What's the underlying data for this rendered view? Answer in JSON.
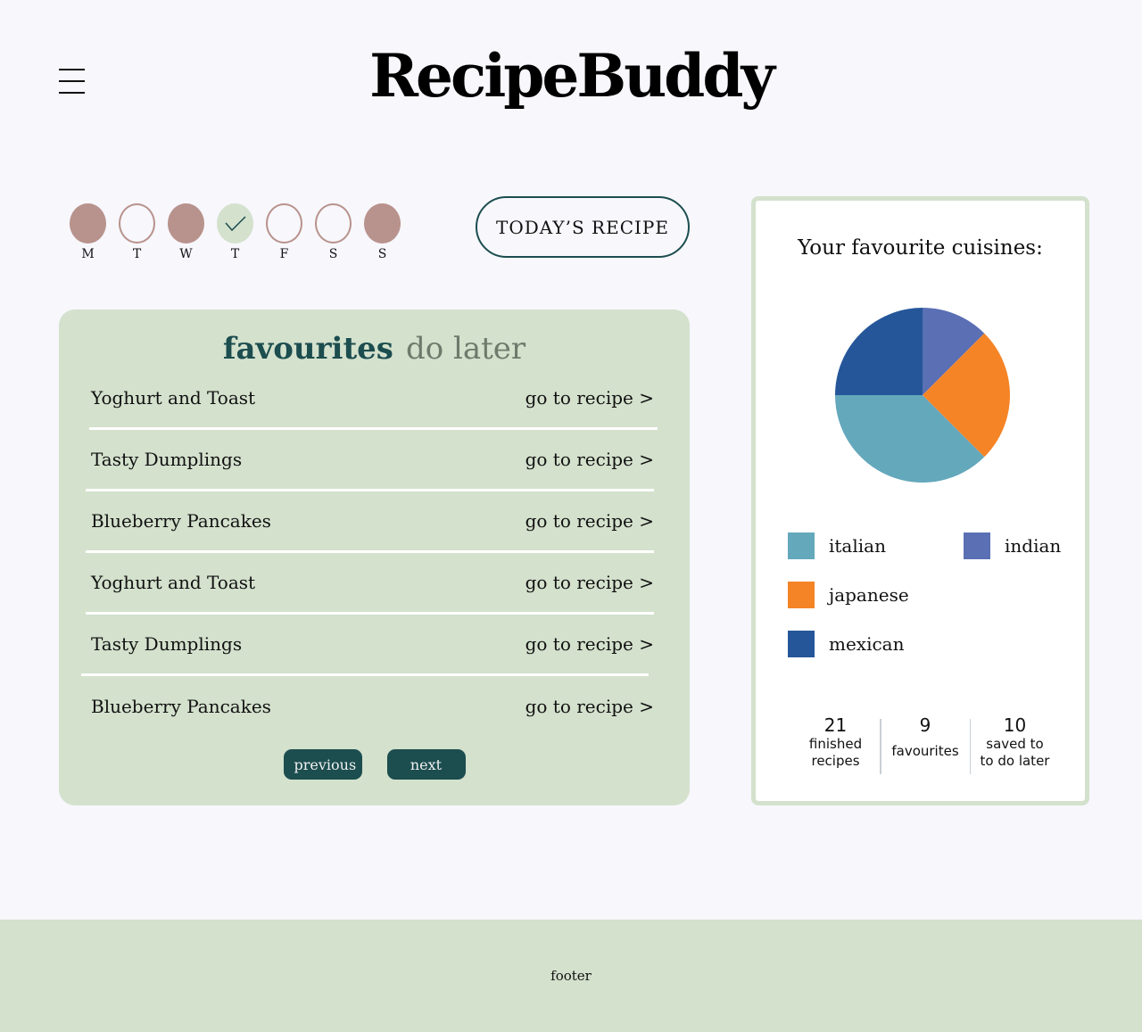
{
  "app": {
    "title": "RecipeBuddy"
  },
  "week": {
    "days": [
      {
        "label": "M",
        "state": "done"
      },
      {
        "label": "T",
        "state": "empty"
      },
      {
        "label": "W",
        "state": "done"
      },
      {
        "label": "T",
        "state": "today"
      },
      {
        "label": "F",
        "state": "empty"
      },
      {
        "label": "S",
        "state": "empty"
      },
      {
        "label": "S",
        "state": "done"
      }
    ]
  },
  "today_button": "TODAY’S RECIPE",
  "list": {
    "tabs": {
      "favourites": "favourites",
      "do_later": "do later"
    },
    "link_label": "go to recipe >",
    "items": [
      "Yoghurt and Toast",
      "Tasty Dumplings",
      "Blueberry Pancakes",
      "Yoghurt and Toast",
      "Tasty Dumplings",
      "Blueberry Pancakes"
    ],
    "previous": "previous",
    "next": "next"
  },
  "cuisines": {
    "heading": "Your favourite cuisines:",
    "chart_data": {
      "type": "pie",
      "categories": [
        "indian",
        "japanese",
        "italian",
        "mexican"
      ],
      "values": [
        12.5,
        25,
        37.5,
        25
      ],
      "colors": [
        "#5a6fb4",
        "#f58426",
        "#64a8bc",
        "#25569a"
      ]
    },
    "legend": [
      {
        "label": "italian",
        "color": "#64a8bc"
      },
      {
        "label": "indian",
        "color": "#5a6fb4"
      },
      {
        "label": "japanese",
        "color": "#f58426"
      },
      {
        "label": "mexican",
        "color": "#25569a"
      }
    ]
  },
  "stats": [
    {
      "value": "21",
      "caption_1": "finished",
      "caption_2": "recipes"
    },
    {
      "value": "9",
      "caption_1": "favourites",
      "caption_2": ""
    },
    {
      "value": "10",
      "caption_1": "saved to",
      "caption_2": "to do later"
    }
  ],
  "footer": "footer"
}
